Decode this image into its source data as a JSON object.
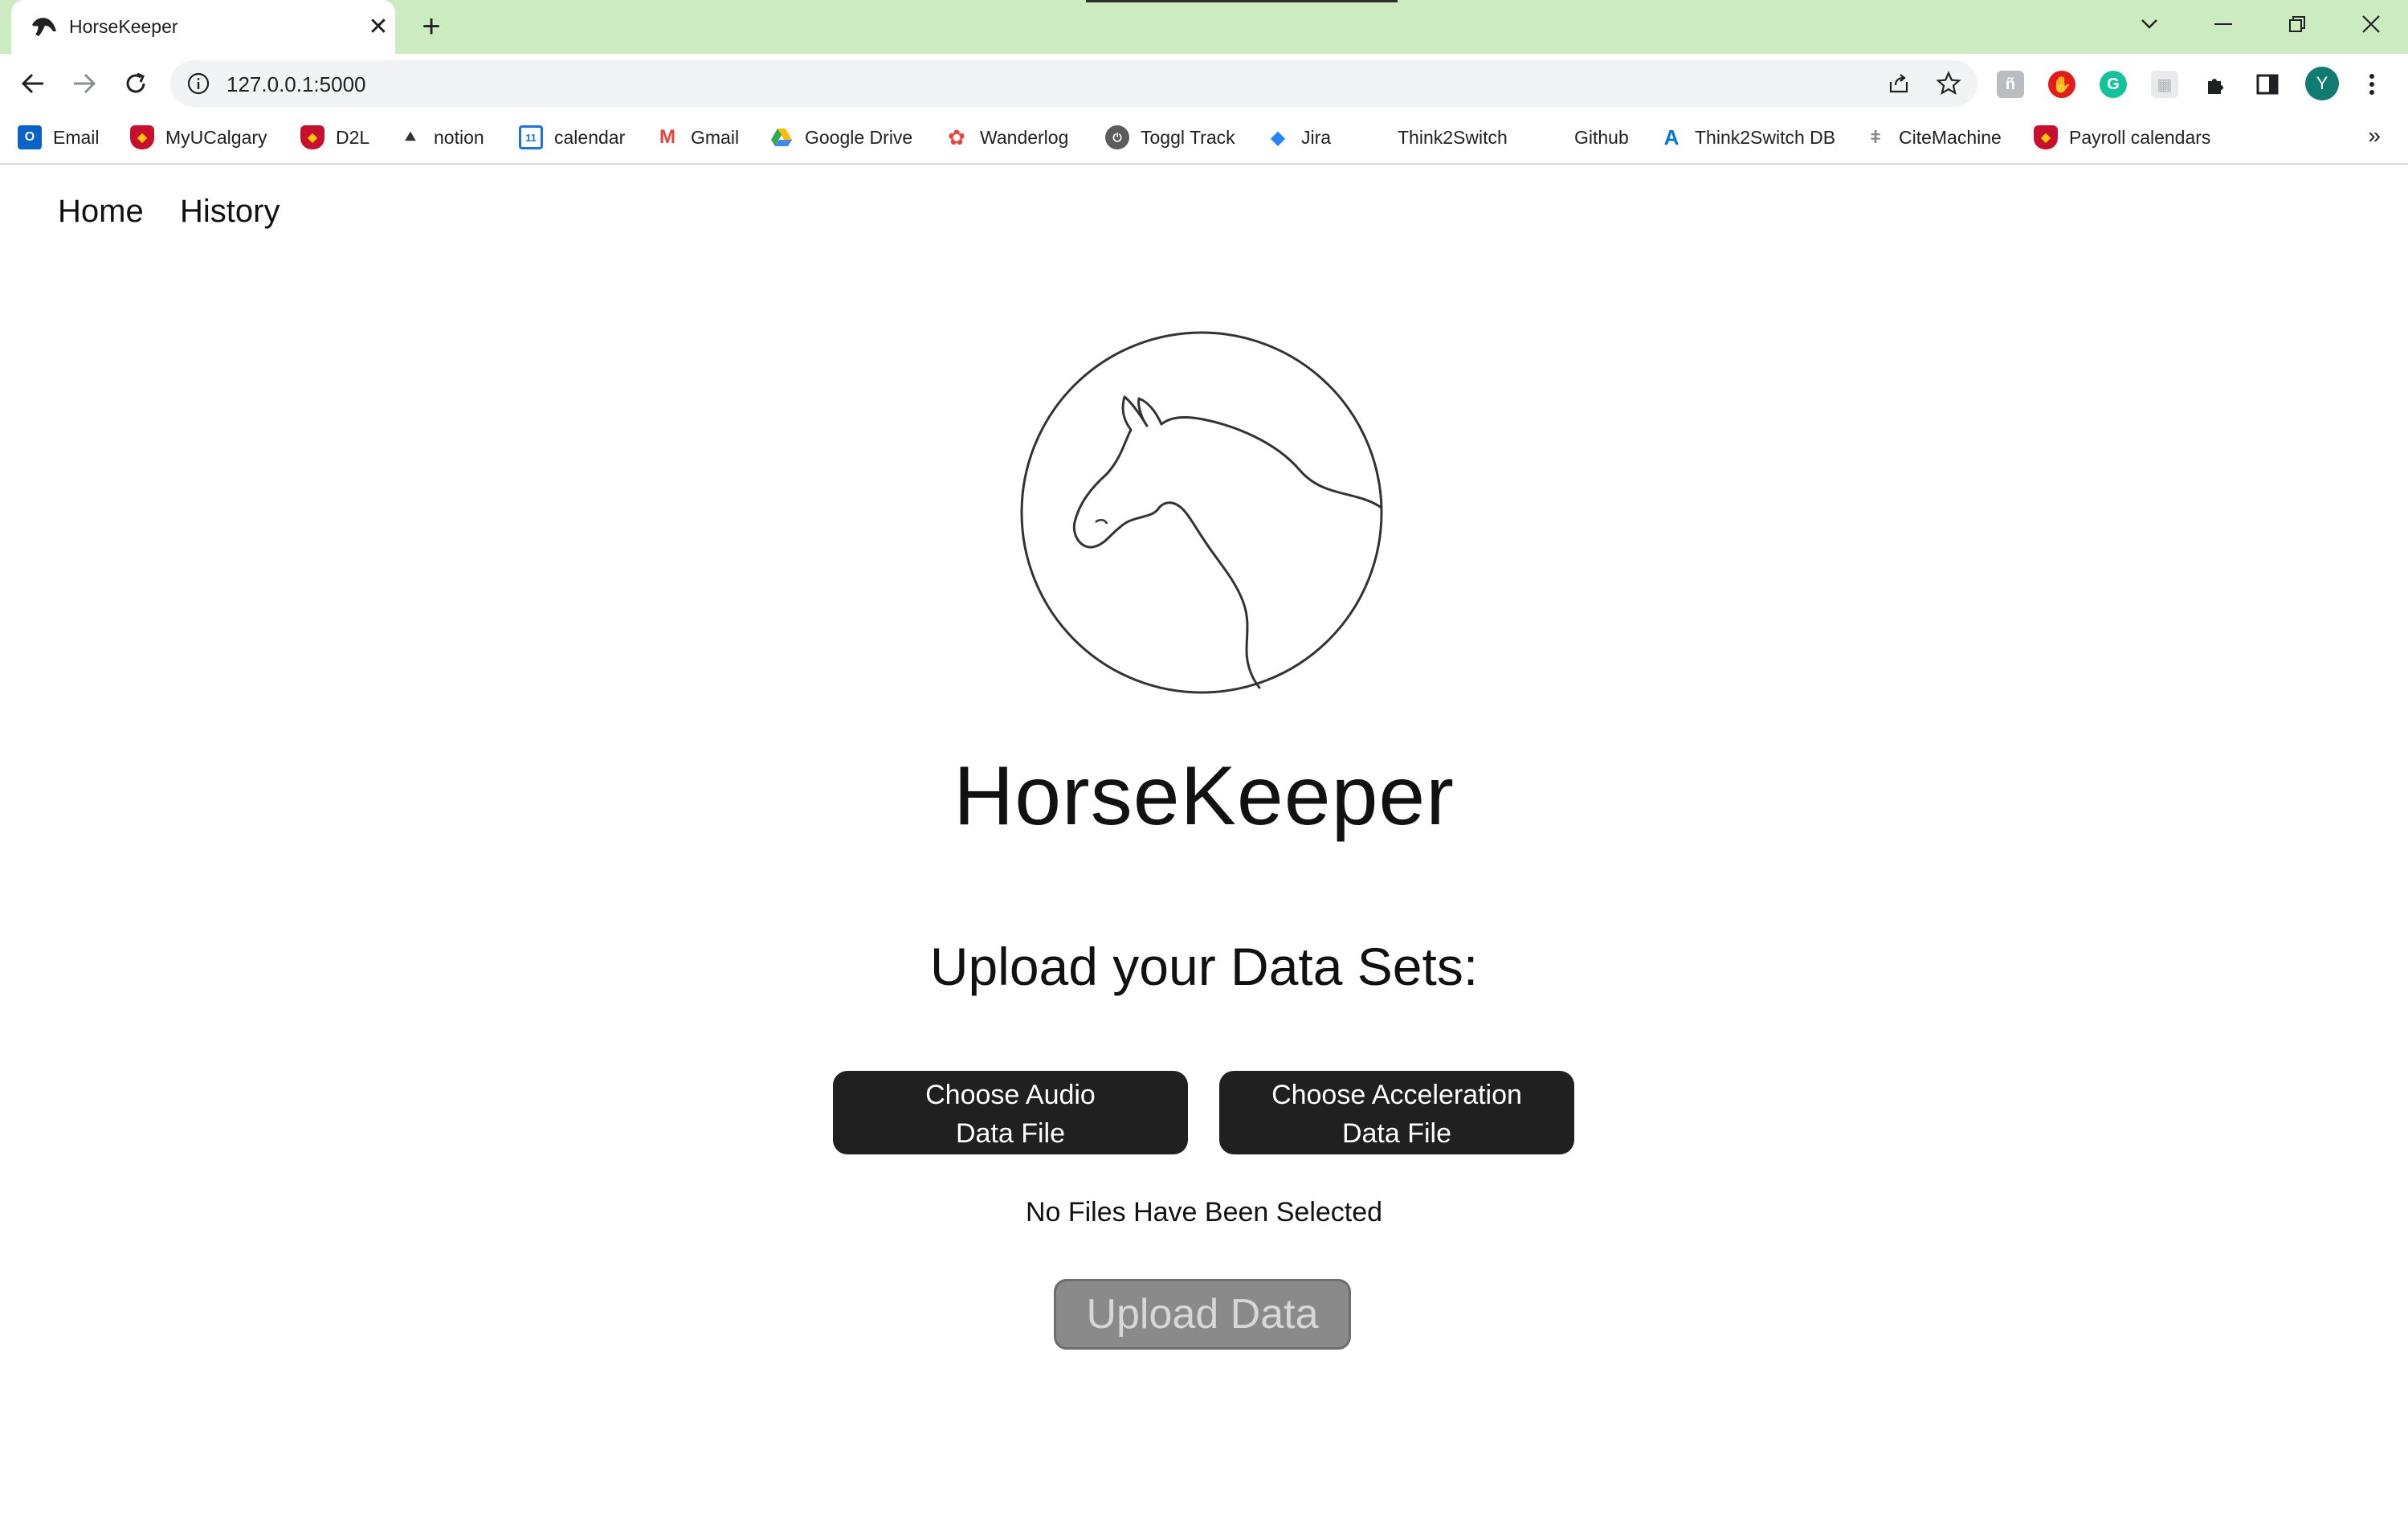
{
  "browser": {
    "tab": {
      "title": "HorseKeeper"
    },
    "omnibox": {
      "url": "127.0.0.1:5000"
    },
    "avatar_initial": "Y",
    "accent_color": "#cdebc0"
  },
  "bookmarks": [
    {
      "label": "Email",
      "icon": "outlook-icon"
    },
    {
      "label": "MyUCalgary",
      "icon": "ucalgary-crest-icon"
    },
    {
      "label": "D2L",
      "icon": "ucalgary-crest-icon"
    },
    {
      "label": "notion",
      "icon": "notion-icon"
    },
    {
      "label": "calendar",
      "icon": "calendar-icon"
    },
    {
      "label": "Gmail",
      "icon": "gmail-icon"
    },
    {
      "label": "Google Drive",
      "icon": "drive-icon"
    },
    {
      "label": "Wanderlog",
      "icon": "wanderlog-icon"
    },
    {
      "label": "Toggl Track",
      "icon": "toggl-icon"
    },
    {
      "label": "Jira",
      "icon": "jira-icon"
    },
    {
      "label": "Think2Switch",
      "icon": ""
    },
    {
      "label": "Github",
      "icon": ""
    },
    {
      "label": "Think2Switch DB",
      "icon": "azure-icon"
    },
    {
      "label": "CiteMachine",
      "icon": "citemachine-icon"
    },
    {
      "label": "Payroll calendars",
      "icon": "ucalgary-crest-icon"
    }
  ],
  "nav": {
    "home": "Home",
    "history": "History"
  },
  "main": {
    "title": "HorseKeeper",
    "subtitle": "Upload your Data Sets:",
    "audio_button": {
      "line1": "Choose Audio",
      "line2": "Data File"
    },
    "accel_button": {
      "line1": "Choose Acceleration",
      "line2": "Data File"
    },
    "status": "No Files Have Been Selected",
    "upload_button": "Upload Data"
  }
}
